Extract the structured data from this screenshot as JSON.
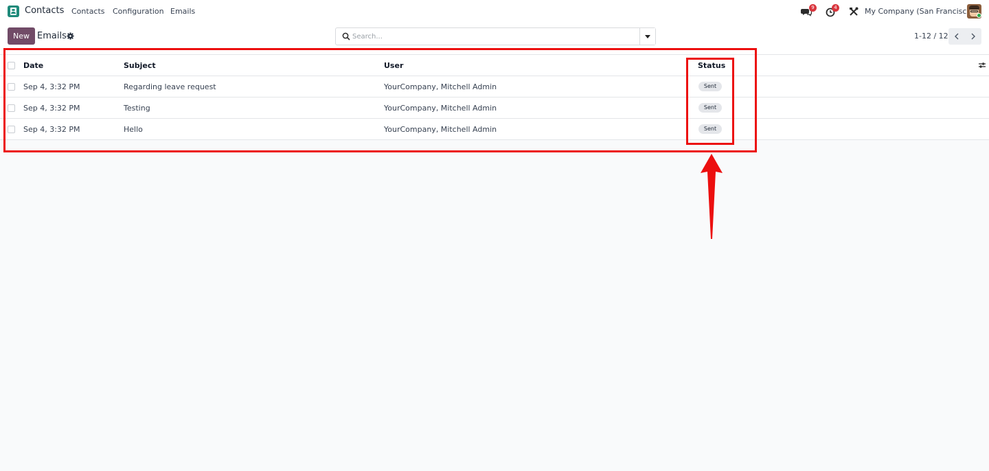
{
  "navbar": {
    "app_name": "Contacts",
    "menus": [
      "Contacts",
      "Configuration",
      "Emails"
    ],
    "messages_count": "9",
    "activities_count": "4",
    "company": "My Company (San Francisco)"
  },
  "control_panel": {
    "new_label": "New",
    "title": "Emails",
    "search_placeholder": "Search...",
    "pager": "1-12 / 12"
  },
  "list": {
    "columns": [
      "Date",
      "Subject",
      "User",
      "Status"
    ],
    "rows": [
      {
        "date": "Sep 4, 3:32 PM",
        "subject": "Regarding leave request",
        "user": "YourCompany, Mitchell Admin",
        "status": "Sent"
      },
      {
        "date": "Sep 4, 3:32 PM",
        "subject": "Testing",
        "user": "YourCompany, Mitchell Admin",
        "status": "Sent"
      },
      {
        "date": "Sep 4, 3:32 PM",
        "subject": "Hello",
        "user": "YourCompany, Mitchell Admin",
        "status": "Sent"
      }
    ]
  },
  "colors": {
    "brand": "#714b67",
    "app_icon": "#1e8a7a",
    "badge": "#d9363e",
    "annotation": "#ec0f0f"
  },
  "icons": [
    "contacts-app-icon",
    "messages-icon",
    "activities-icon",
    "debug-tools-icon",
    "gear-icon",
    "search-icon",
    "caret-down-icon",
    "chevron-left-icon",
    "chevron-right-icon",
    "optional-columns-icon"
  ]
}
